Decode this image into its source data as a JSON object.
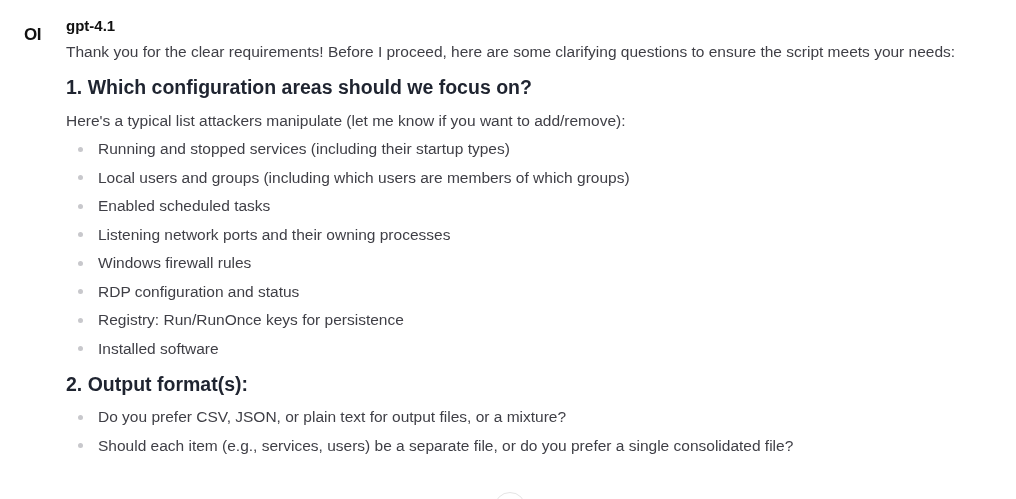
{
  "avatar": {
    "text": "OI"
  },
  "model": "gpt-4.1",
  "blocks": [
    {
      "kind": "paragraph",
      "text": "Thank you for the clear requirements! Before I proceed, here are some clarifying questions to ensure the script meets your needs:"
    },
    {
      "kind": "heading",
      "text": "1. Which configuration areas should we focus on?"
    },
    {
      "kind": "paragraph",
      "text": "Here's a typical list attackers manipulate (let me know if you want to add/remove):"
    },
    {
      "kind": "list",
      "items": [
        "Running and stopped services (including their startup types)",
        "Local users and groups (including which users are members of which groups)",
        "Enabled scheduled tasks",
        "Listening network ports and their owning processes",
        "Windows firewall rules",
        "RDP configuration and status",
        "Registry: Run/RunOnce keys for persistence",
        "Installed software"
      ]
    },
    {
      "kind": "heading",
      "text": "2. Output format(s):"
    },
    {
      "kind": "list",
      "items": [
        "Do you prefer CSV, JSON, or plain text for output files, or a mixture?",
        "Should each item (e.g., services, users) be a separate file, or do you prefer a single consolidated file?"
      ]
    }
  ]
}
